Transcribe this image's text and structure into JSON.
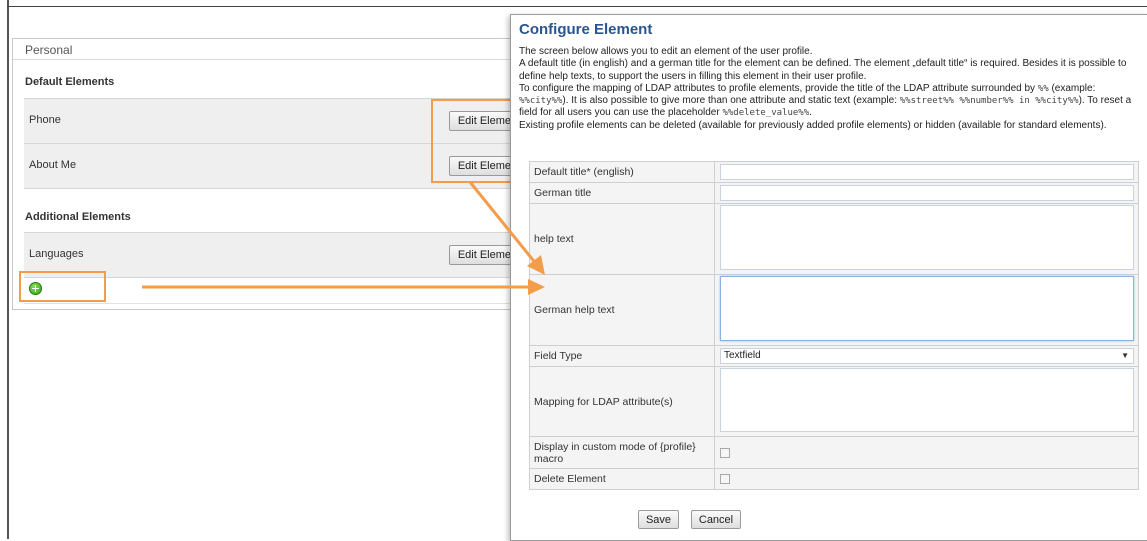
{
  "profile_panel": {
    "title": "Personal",
    "default_heading": "Default Elements",
    "default_elements": [
      {
        "label": "Phone",
        "button": "Edit Element"
      },
      {
        "label": "About Me",
        "button": "Edit Element"
      }
    ],
    "additional_heading": "Additional Elements",
    "additional_elements": [
      {
        "label": "Languages",
        "button": "Edit Element"
      }
    ]
  },
  "dialog": {
    "title": "Configure Element",
    "desc_line1": "The screen below allows you to edit an element of the user profile.",
    "desc_line2": "A default title (in english) and a german title for the element can be defined. The element „default title“ is required. Besides it is possible to define help texts, to support the users in filling this element in their user profile.",
    "desc_line3_a": "To configure the mapping of LDAP attributes to profile elements, provide the title of the LDAP attribute surrounded by ",
    "desc_code_pct": "%%",
    "desc_line3_b": " (example: ",
    "desc_code_city": "%%city%%",
    "desc_line3_c": "). It is also possible to give more than one attribute and static text (example: ",
    "desc_code_combo": "%%street%% %%number%% in %%city%%",
    "desc_line3_d": "). To reset a field for all users you can use the placeholder ",
    "desc_code_delete": "%%delete_value%%",
    "desc_line3_e": ".",
    "desc_line4": "Existing profile elements can be deleted (available for previously added profile elements) or hidden (available for standard elements).",
    "fields": {
      "default_title": "Default title* (english)",
      "german_title": "German title",
      "help_text": "help text",
      "german_help_text": "German help text",
      "field_type": "Field Type",
      "field_type_value": "Textfield",
      "ldap_mapping": "Mapping for LDAP attribute(s)",
      "display_custom": "Display in custom mode of {profile} macro",
      "delete_element": "Delete Element"
    },
    "save_label": "Save",
    "cancel_label": "Cancel"
  },
  "colors": {
    "highlight": "#f39c4a",
    "title_blue": "#2a5590",
    "add_icon_green": "#3aa522"
  }
}
